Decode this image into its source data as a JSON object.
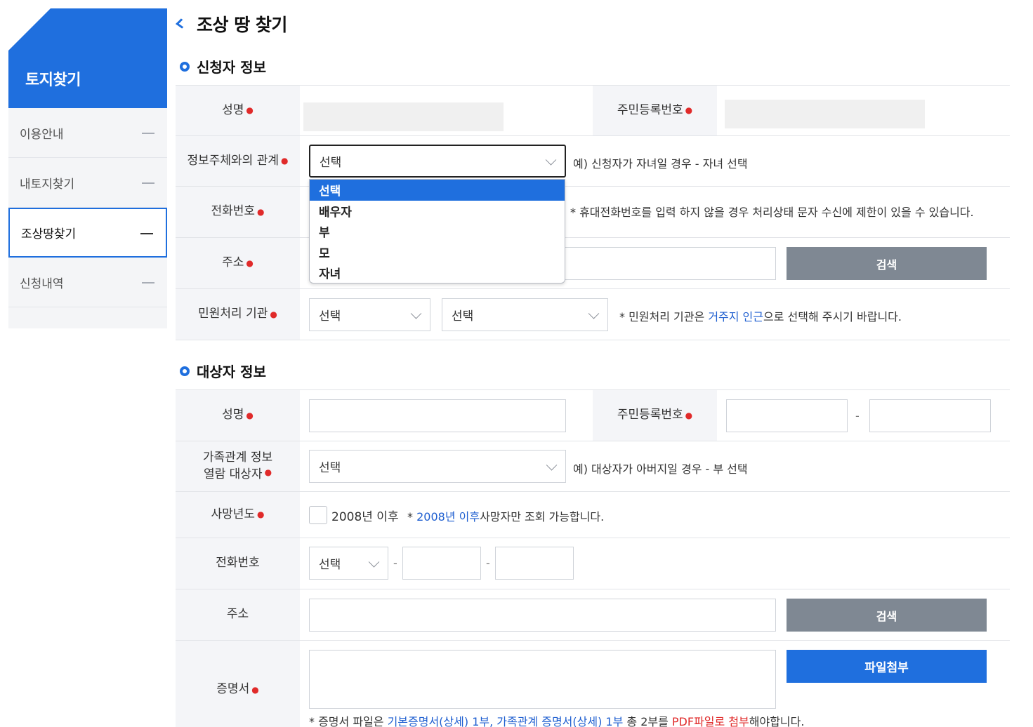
{
  "sidebar": {
    "title": "토지찾기",
    "items": [
      {
        "label": "이용안내"
      },
      {
        "label": "내토지찾기"
      },
      {
        "label": "조상땅찾기"
      },
      {
        "label": "신청내역"
      }
    ]
  },
  "page": {
    "title": "조상 땅 찾기"
  },
  "applicant": {
    "section_title": "신청자 정보",
    "name_label": "성명",
    "rrn_label": "주민등록번호",
    "relation_label": "정보주체와의 관계",
    "relation_value": "선택",
    "relation_note": "예) 신청자가 자녀일 경우 - 자녀 선택",
    "relation_options": [
      "선택",
      "배우자",
      "부",
      "모",
      "자녀"
    ],
    "phone_label": "전화번호",
    "phone_note": "* 휴대전화번호를 입력 하지 않을 경우 처리상태 문자 수신에 제한이 있을 수 있습니다.",
    "address_label": "주소",
    "search_button": "검색",
    "office_label": "민원처리 기관",
    "office_select1": "선택",
    "office_select2": "선택",
    "office_note_pre": "* 민원처리 기관은 ",
    "office_note_highlight": "거주지 인근",
    "office_note_post": "으로 선택해 주시기 바랍니다."
  },
  "target": {
    "section_title": "대상자 정보",
    "name_label": "성명",
    "rrn_label": "주민등록번호",
    "rrn_separator": "-",
    "family_label_line1": "가족관계 정보",
    "family_label_line2": "열람 대상자",
    "family_value": "선택",
    "family_note": "예) 대상자가 아버지일 경우 - 부 선택",
    "death_label": "사망년도",
    "death_checkbox_label": "2008년 이후",
    "death_note_pre": "* ",
    "death_note_highlight": "2008년 이후",
    "death_note_post": "사망자만 조회 가능합니다.",
    "phone_label": "전화번호",
    "phone_select": "선택",
    "phone_sep": "-",
    "address_label": "주소",
    "search_button": "검색",
    "cert_label": "증명서",
    "attach_button": "파일첨부",
    "cert_note_pre": "* 증명서 파일은 ",
    "cert_note_blue": "기본증명서(상세) 1부, 가족관계 증명서(상세) 1부",
    "cert_note_mid": " 총 2부를 ",
    "cert_note_red": "PDF파일로 첨부",
    "cert_note_post": "해야합니다."
  },
  "colors": {
    "accent": "#1f6fde",
    "required": "#e02a2a",
    "button_gray": "#7f8893"
  }
}
